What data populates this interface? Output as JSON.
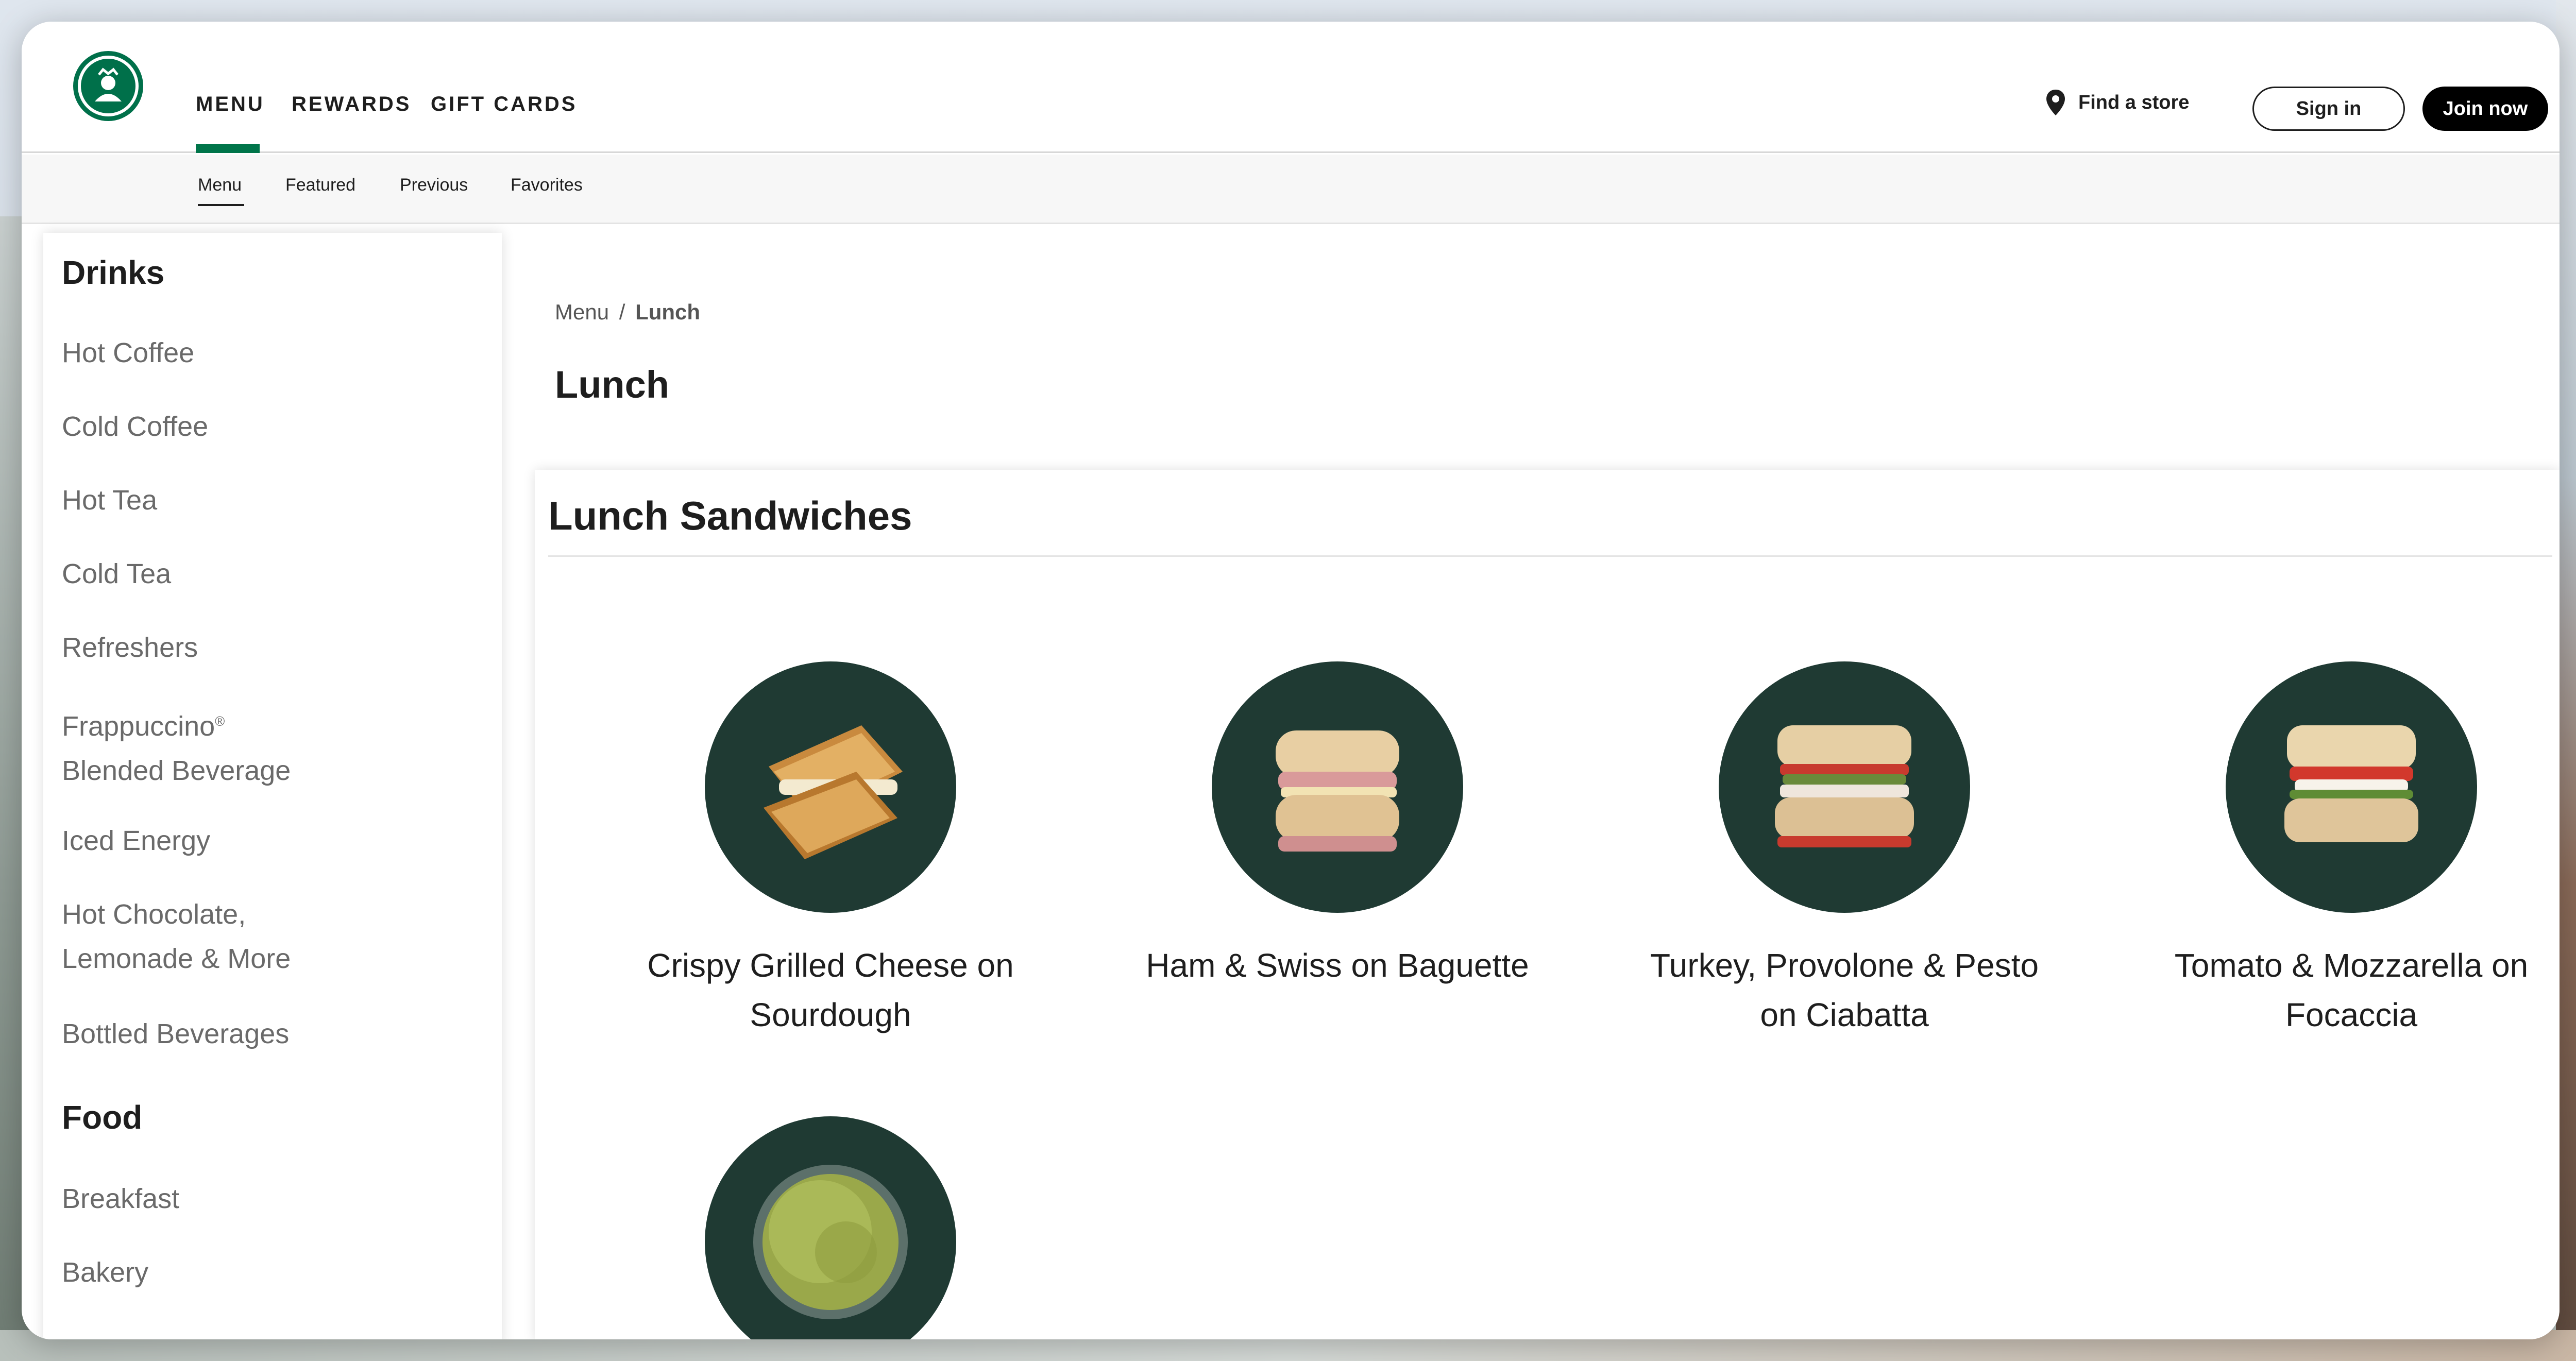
{
  "header": {
    "nav": [
      "MENU",
      "REWARDS",
      "GIFT CARDS"
    ],
    "find_store": "Find a store",
    "sign_in": "Sign in",
    "join_now": "Join now"
  },
  "subnav": [
    "Menu",
    "Featured",
    "Previous",
    "Favorites"
  ],
  "sidebar": {
    "drinks_heading": "Drinks",
    "drinks": [
      "Hot Coffee",
      "Cold Coffee",
      "Hot Tea",
      "Cold Tea",
      "Refreshers",
      "Frappuccino",
      "Blended Beverage",
      "Iced Energy",
      "Hot Chocolate,",
      "Lemonade & More",
      "Bottled Beverages"
    ],
    "frappuccino_mark": "®",
    "food_heading": "Food",
    "food": [
      "Breakfast",
      "Bakery"
    ]
  },
  "breadcrumb": {
    "root": "Menu",
    "separator": "/",
    "current": "Lunch"
  },
  "page_title": "Lunch",
  "section": {
    "title": "Lunch Sandwiches",
    "products": [
      {
        "line1": "Crispy Grilled Cheese on",
        "line2": "Sourdough"
      },
      {
        "line1": "Ham & Swiss on Baguette",
        "line2": ""
      },
      {
        "line1": "Turkey, Provolone & Pesto",
        "line2": "on Ciabatta"
      },
      {
        "line1": "Tomato & Mozzarella on",
        "line2": "Focaccia"
      },
      {
        "line1": "",
        "line2": ""
      }
    ]
  },
  "colors": {
    "brand_green": "#00704a",
    "product_bg": "#1f3a33",
    "accent_underline": "#00754a"
  }
}
